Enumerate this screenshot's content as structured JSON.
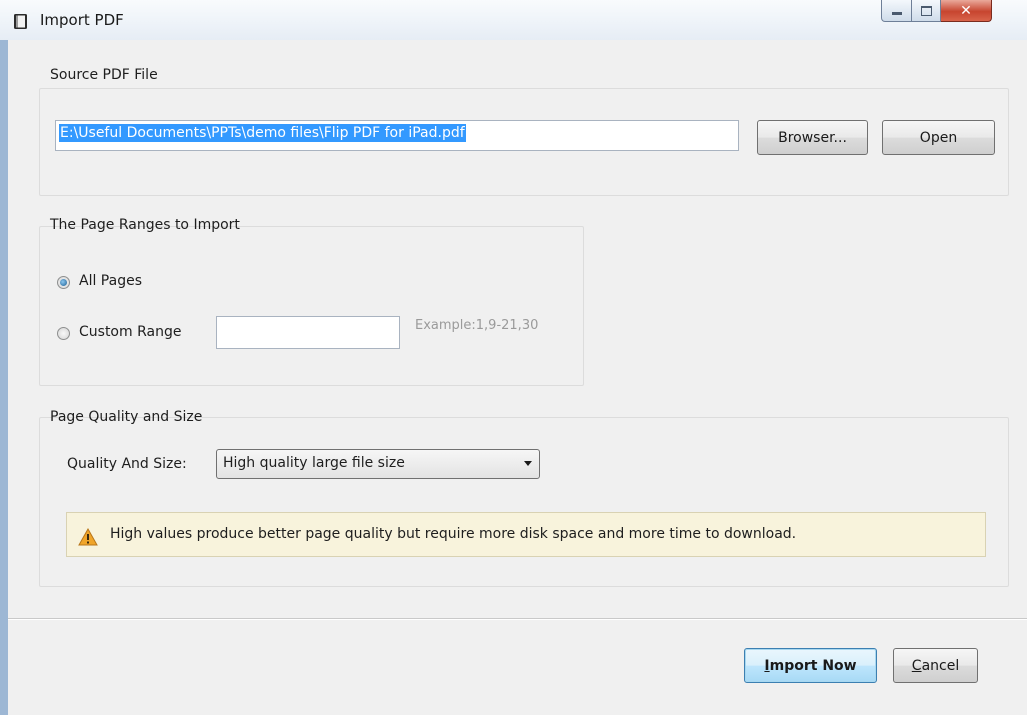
{
  "window": {
    "title": "Import PDF",
    "icon": "app-book-icon"
  },
  "source": {
    "group_label": "Source PDF File",
    "path_value": "E:\\Useful Documents\\PPTs\\demo files\\Flip PDF for iPad.pdf",
    "browse_label": "Browser...",
    "open_label": "Open"
  },
  "page_ranges": {
    "group_label": "The Page Ranges to Import",
    "all_pages_label": "All Pages",
    "all_pages_selected": true,
    "custom_range_label": "Custom Range",
    "custom_range_selected": false,
    "custom_range_value": "",
    "example_hint": "Example:1,9-21,30"
  },
  "quality": {
    "group_label": "Page Quality and Size",
    "field_label": "Quality And Size:",
    "selected": "High quality large file size",
    "warning_icon": "warning-icon",
    "warning_text": "High values produce better page quality but require more disk space and more time to download."
  },
  "footer": {
    "import_first": "I",
    "import_rest": "mport Now",
    "cancel_first": "C",
    "cancel_rest": "ancel"
  },
  "colors": {
    "selection": "#3399ff",
    "warning_bg": "#f8f3dc",
    "close_button": "#c7452f"
  }
}
